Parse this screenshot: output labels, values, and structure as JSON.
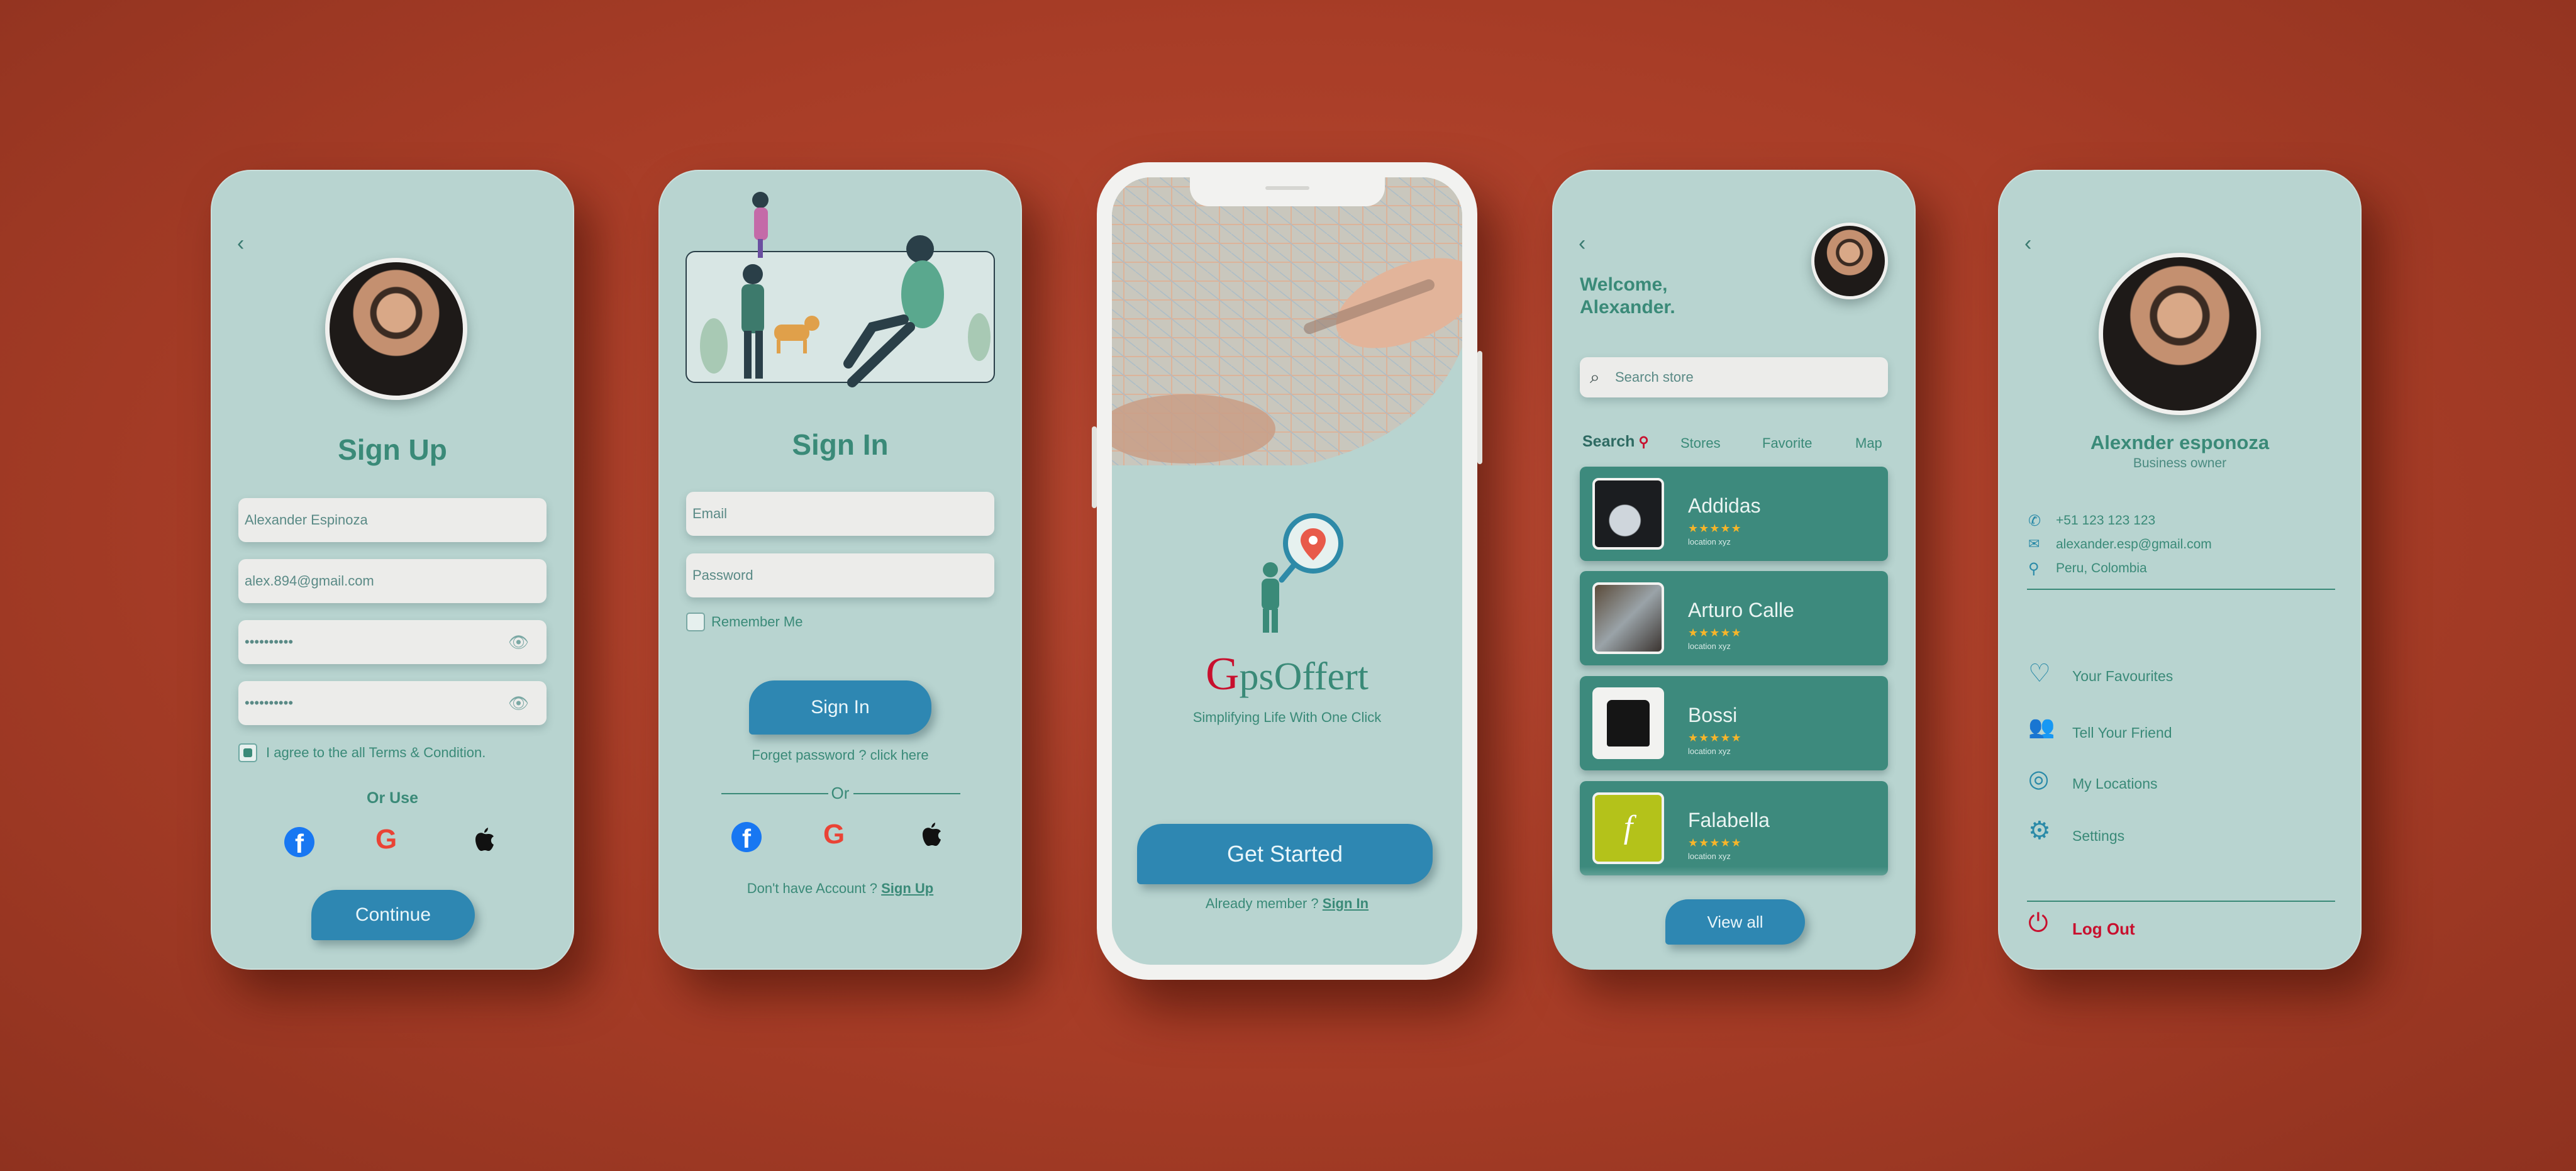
{
  "signup": {
    "back": "‹",
    "title": "Sign Up",
    "name_value": "Alexander Espinoza",
    "email_value": "alex.894@gmail.com",
    "password_mask": "••••••••••",
    "confirm_mask": "••••••••••",
    "terms_label": "I agree to the all Terms & Condition.",
    "or_use": "Or Use",
    "continue_label": "Continue"
  },
  "signin": {
    "title": "Sign In",
    "email_placeholder": "Email",
    "password_placeholder": "Password",
    "remember_label": "Remember Me",
    "signin_label": "Sign In",
    "forgot_label": "Forget password ? click here",
    "or_label": "Or",
    "no_account_label": "Don't have Account ?",
    "signup_link": "Sign Up"
  },
  "landing": {
    "brand": "psOffert",
    "tagline": "Simplifying Life With One Click",
    "get_started_label": "Get Started",
    "member_label": "Already member ?",
    "signin_link": "Sign In"
  },
  "home": {
    "back": "‹",
    "welcome_line1": "Welcome,",
    "welcome_line2": "Alexander.",
    "search_placeholder": "Search store",
    "tabs": [
      "Search",
      "Stores",
      "Favorite",
      "Map"
    ],
    "stores": [
      {
        "name": "Addidas",
        "stars": "★★★★★",
        "location": "location xyz"
      },
      {
        "name": "Arturo Calle",
        "stars": "★★★★★",
        "location": "location xyz"
      },
      {
        "name": "Bossi",
        "stars": "★★★★★",
        "location": "location xyz"
      },
      {
        "name": "Falabella",
        "stars": "★★★★★",
        "location": "location xyz"
      }
    ],
    "view_all_label": "View all"
  },
  "profile": {
    "back": "‹",
    "name": "Alexnder esponoza",
    "role": "Business owner",
    "phone": "+51 123 123 123",
    "email": "alexander.esp@gmail.com",
    "location": "Peru, Colombia",
    "menu": [
      "Your Favourites",
      "Tell Your Friend",
      "My Locations",
      "Settings"
    ],
    "logout_label": "Log Out"
  },
  "colors": {
    "background": "#a83d27",
    "screen": "#b8d4d0",
    "accent_teal": "#3a8a78",
    "button_blue": "#2e87b2",
    "card": "#3d8a7d",
    "logout_red": "#c8102e"
  }
}
